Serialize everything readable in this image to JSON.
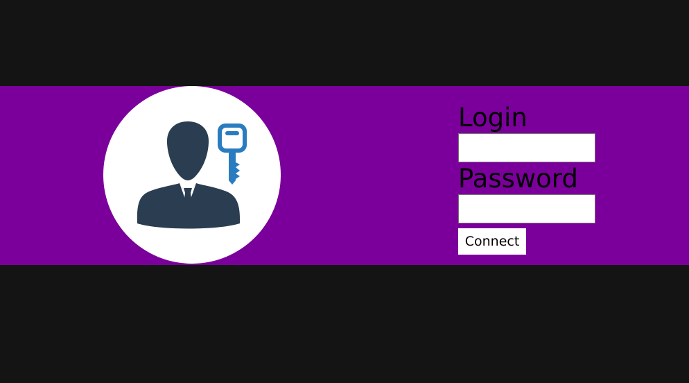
{
  "colors": {
    "page_background": "#141414",
    "band": "#7b009b",
    "avatar_circle": "#ffffff",
    "user_silhouette": "#2b3d51",
    "key": "#2a7cc0"
  },
  "icons": {
    "avatar": "user-with-key-icon",
    "user": "businessman-icon",
    "key": "key-icon"
  },
  "form": {
    "login_label": "Login",
    "login_value": "",
    "password_label": "Password",
    "password_value": "",
    "connect_label": "Connect"
  }
}
